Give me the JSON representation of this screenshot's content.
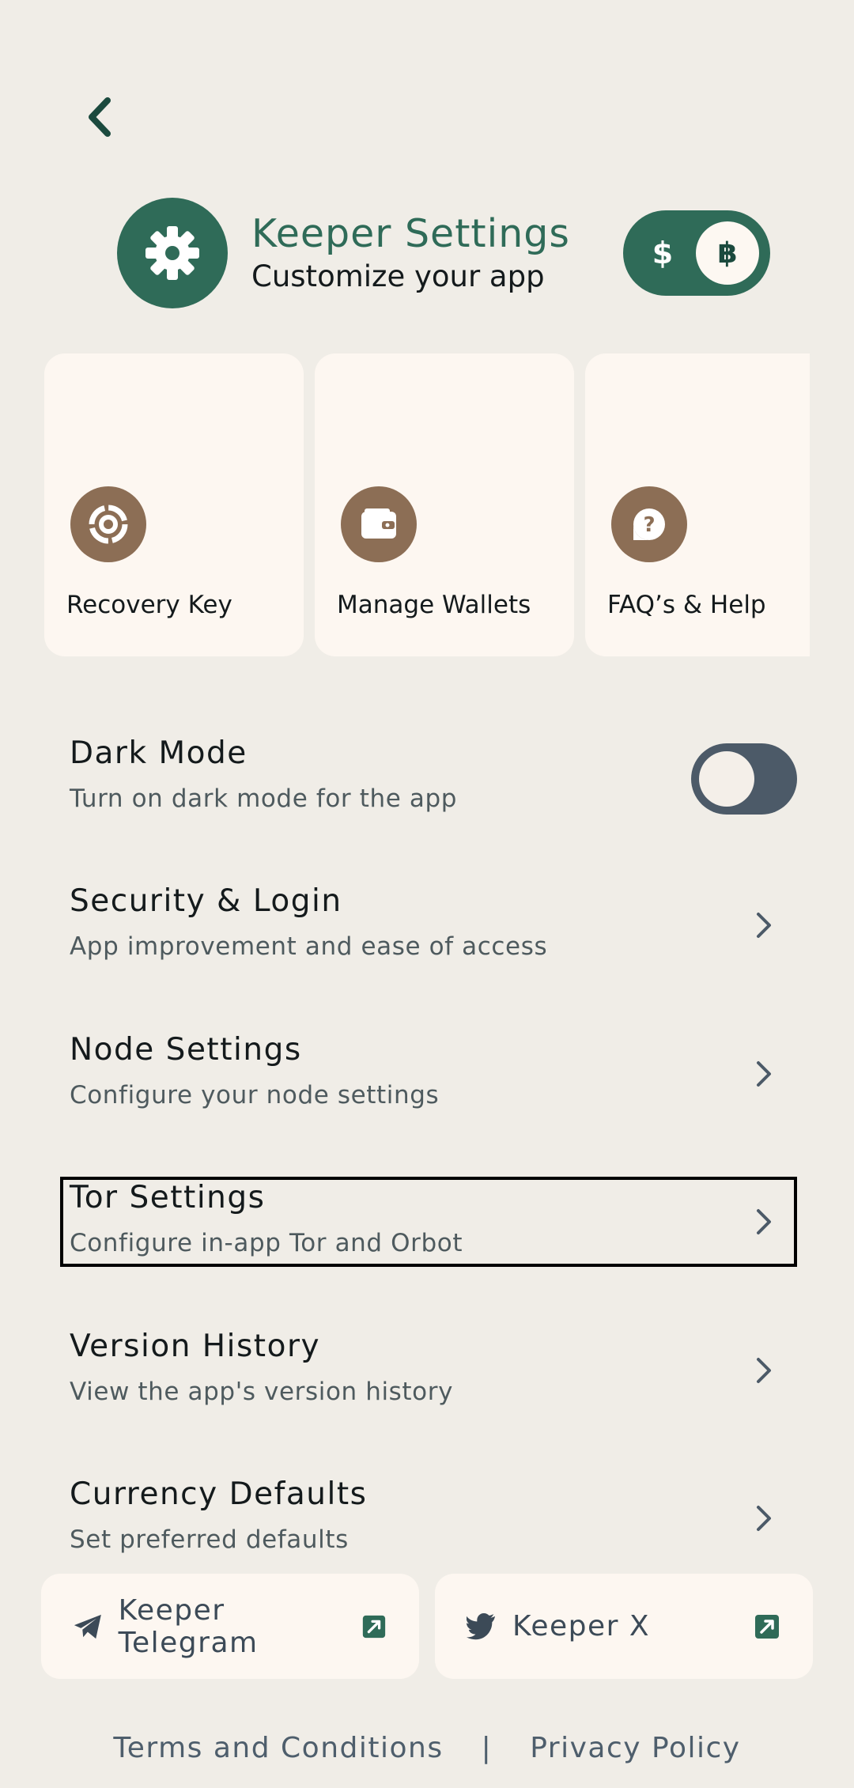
{
  "header": {
    "title": "Keeper Settings",
    "subtitle": "Customize your app",
    "icon": "gear-icon",
    "currency_toggle": {
      "left_symbol": "$",
      "right_symbol": "฿",
      "selected": "฿"
    }
  },
  "cards": [
    {
      "label": "Recovery Key",
      "icon": "recovery-key-icon"
    },
    {
      "label": "Manage Wallets",
      "icon": "wallet-icon"
    },
    {
      "label": "FAQ’s & Help",
      "icon": "help-icon"
    }
  ],
  "settings": {
    "dark_mode": {
      "title": "Dark Mode",
      "description": "Turn on dark mode for the app",
      "enabled": false
    },
    "items": [
      {
        "title": "Security & Login",
        "description": "App improvement and ease of access"
      },
      {
        "title": "Node Settings",
        "description": "Configure your node settings"
      },
      {
        "title": "Tor Settings",
        "description": "Configure in-app Tor and Orbot"
      },
      {
        "title": "Version History",
        "description": "View the app's version history"
      },
      {
        "title": "Currency Defaults",
        "description": "Set preferred defaults"
      }
    ]
  },
  "social": {
    "telegram": "Keeper Telegram",
    "x": "Keeper X"
  },
  "footer": {
    "terms": "Terms and Conditions",
    "separator": "|",
    "privacy": "Privacy Policy"
  },
  "colors": {
    "background": "#F0EDE7",
    "accent": "#2F6B58",
    "card": "#FDF7F1",
    "card_icon": "#8C6E55",
    "toggle_off": "#4C5A68"
  }
}
